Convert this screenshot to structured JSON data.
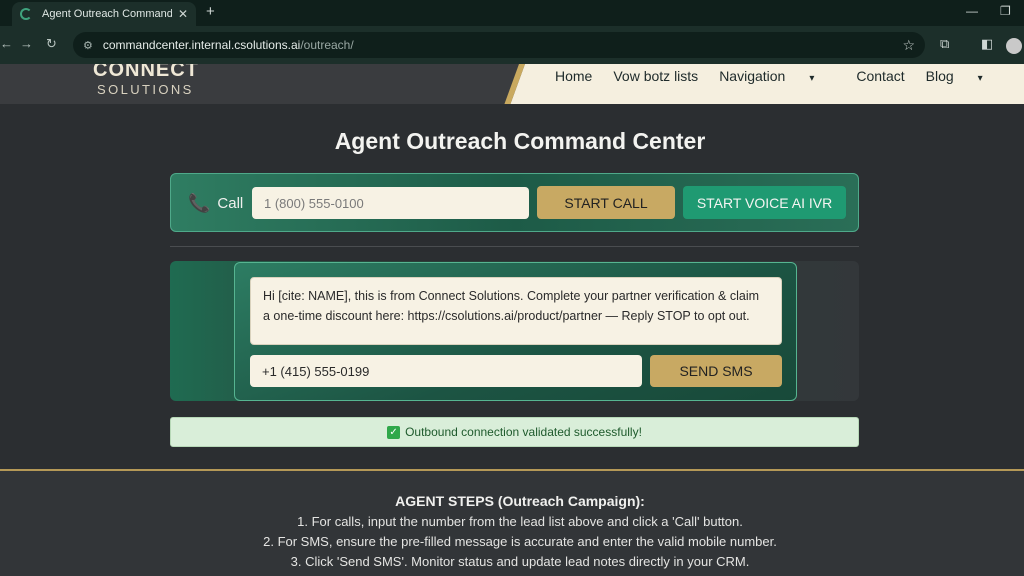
{
  "browser": {
    "tab_title": "Agent Outreach Command Cent",
    "tab_close": "✕",
    "new_tab": "+",
    "url_host": "commandcenter.internal.csolutions.ai",
    "url_path": "/outreach/"
  },
  "header": {
    "logo_line1": "CONNECT",
    "logo_line2": "SOLUTIONS",
    "nav": {
      "home": "Home",
      "lists": "Vow botz lists",
      "navigation": "Navigation",
      "contact": "Contact",
      "blog": "Blog"
    }
  },
  "main": {
    "title": "Agent Outreach Command Center",
    "call": {
      "label": "Call",
      "placeholder": "1 (800) 555-0100",
      "start_call": "START CALL",
      "start_ivr": "START VOICE AI IVR"
    },
    "sms": {
      "message": "Hi [cite: NAME], this is from Connect Solutions. Complete your partner verification & claim a one-time discount here: https://csolutions.ai/product/partner — Reply STOP to opt out.",
      "number": "+1 (415) 555-0199",
      "send": "SEND SMS"
    },
    "status": "Outbound connection validated successfully!"
  },
  "steps": {
    "heading": "AGENT STEPS (Outreach Campaign):",
    "s1": "1. For calls, input the number from the lead list above and click a 'Call' button.",
    "s2": "2. For SMS, ensure the pre-filled message is accurate and enter the valid mobile number.",
    "s3": "3. Click 'Send SMS'. Monitor status and update lead notes directly in your CRM."
  },
  "colors": {
    "accent_green": "#1f9a72",
    "accent_gold": "#c8a963",
    "background": "#2b2e31"
  }
}
